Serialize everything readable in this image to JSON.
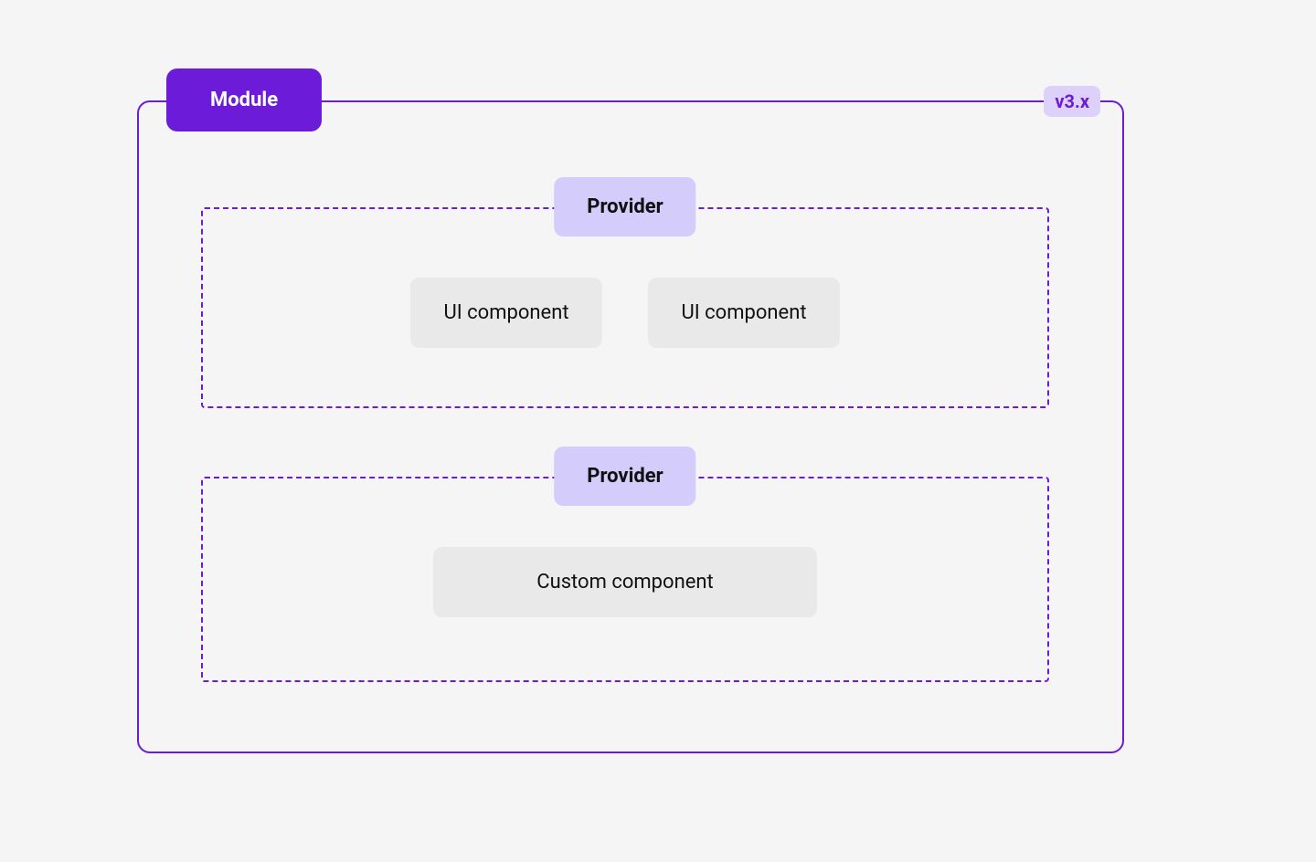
{
  "module": {
    "label": "Module",
    "version": "v3.x"
  },
  "providers": [
    {
      "label": "Provider",
      "components": [
        "UI component",
        "UI component"
      ]
    },
    {
      "label": "Provider",
      "components": [
        "Custom component"
      ]
    }
  ]
}
